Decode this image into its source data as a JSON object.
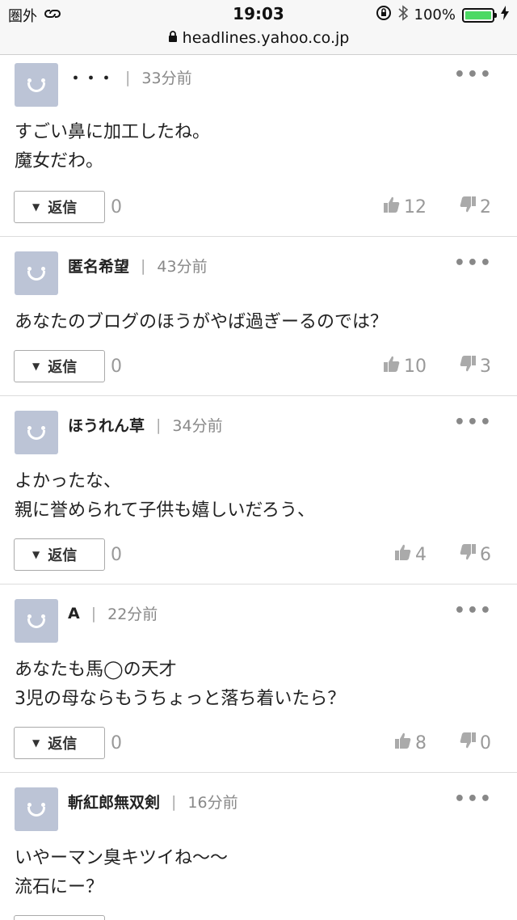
{
  "status_bar": {
    "carrier": "圏外",
    "time": "19:03",
    "battery": "100%",
    "battery_level": 100
  },
  "url_bar": {
    "url": "headlines.yahoo.co.jp"
  },
  "comments": [
    {
      "name": "・・・",
      "time": "33分前",
      "text": "すごい鼻に加工したね。\n魔女だわ。",
      "reply_label": "返信",
      "reply_count": "0",
      "likes": "12",
      "dislikes": "2"
    },
    {
      "name": "匿名希望",
      "time": "43分前",
      "text": "あなたのブログのほうがやば過ぎーるのでは？",
      "reply_label": "返信",
      "reply_count": "0",
      "likes": "10",
      "dislikes": "3"
    },
    {
      "name": "ほうれん草",
      "time": "34分前",
      "text": "よかったな、\n親に誉められて子供も嬉しいだろう、",
      "reply_label": "返信",
      "reply_count": "0",
      "likes": "4",
      "dislikes": "6"
    },
    {
      "name": "A",
      "time": "22分前",
      "text": "あなたも馬◯の天才\n3児の母ならもうちょっと落ち着いたら？",
      "reply_label": "返信",
      "reply_count": "0",
      "likes": "8",
      "dislikes": "0"
    },
    {
      "name": "斬紅郎無双剣",
      "time": "16分前",
      "text": "いやーマン臭キツイね〜〜\n流石にー？",
      "reply_label": "返信",
      "reply_count": "",
      "likes": "",
      "dislikes": ""
    }
  ]
}
